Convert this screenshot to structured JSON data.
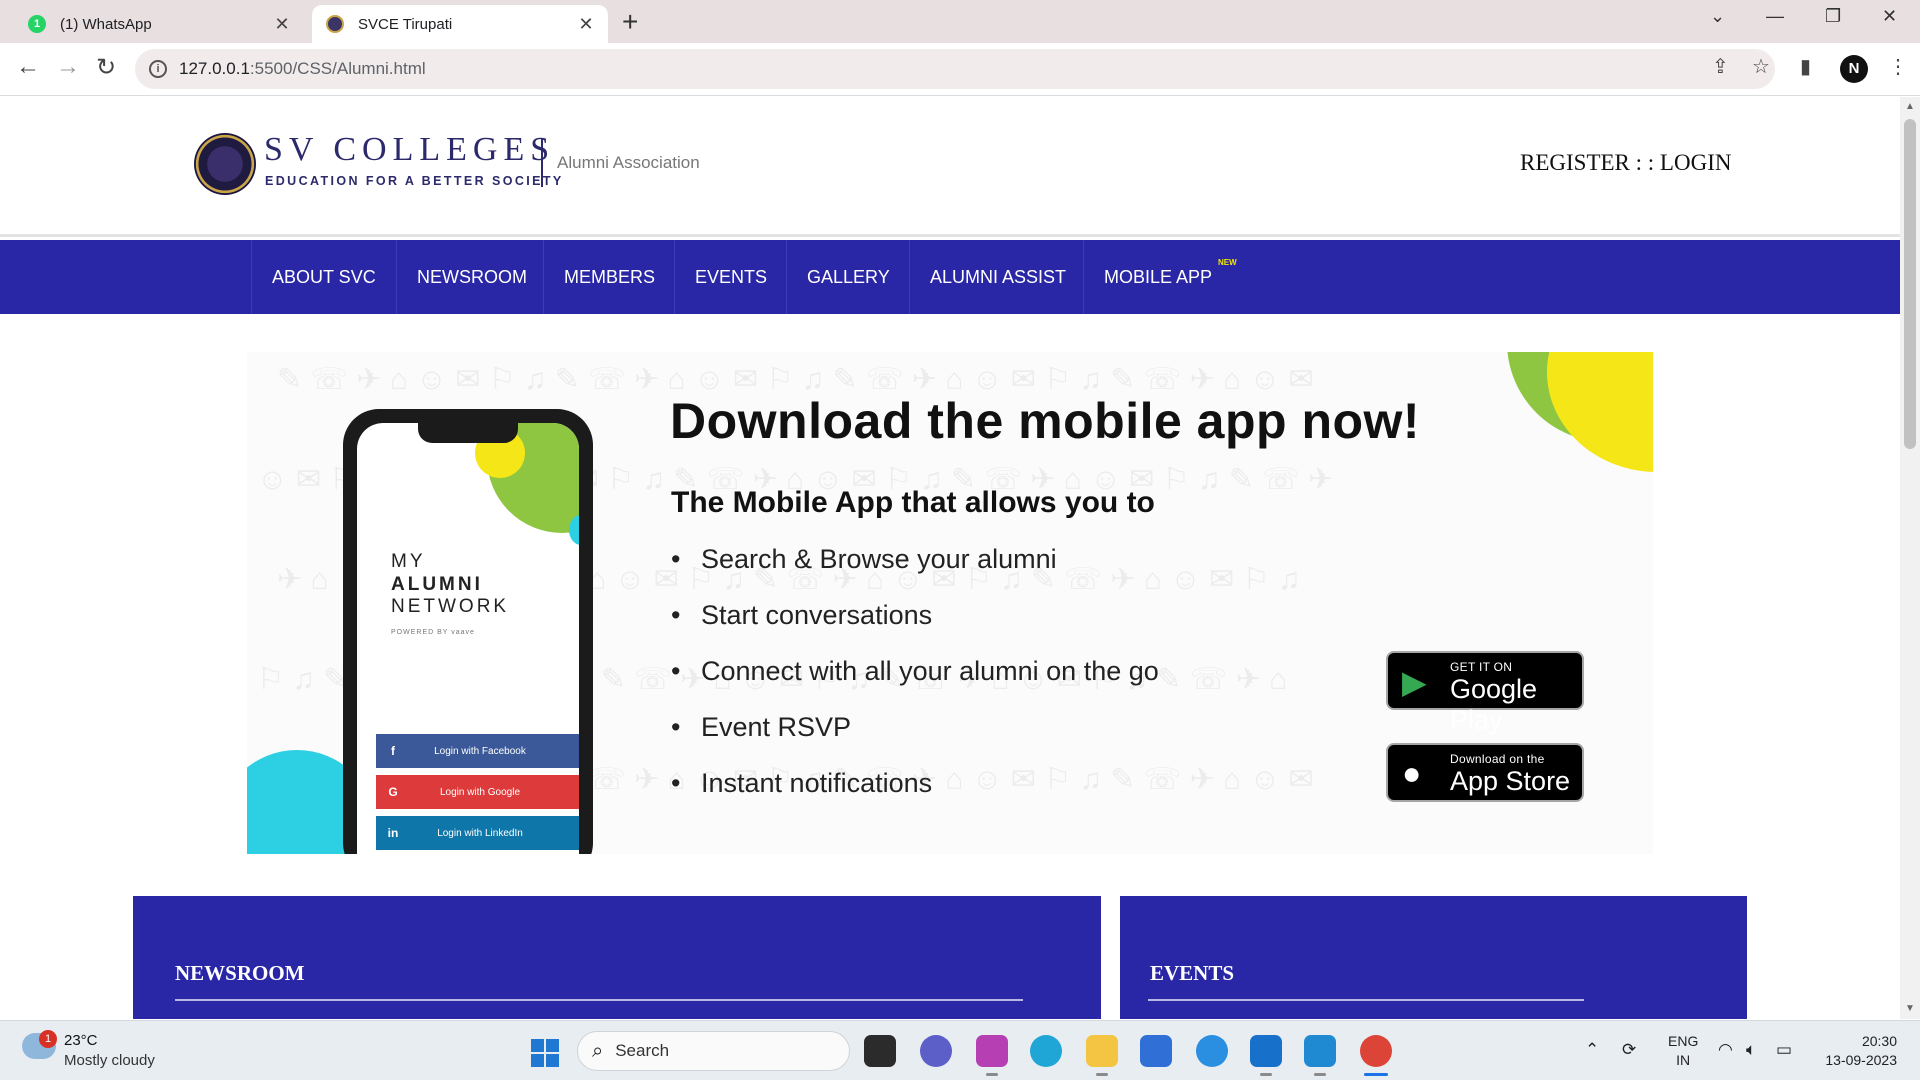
{
  "browser": {
    "tabs": [
      {
        "title": "(1) WhatsApp",
        "badge": "1",
        "active": false
      },
      {
        "title": "SVCE Tirupati",
        "active": true
      }
    ],
    "url_host": "127.0.0.1",
    "url_rest": ":5500/CSS/Alumni.html"
  },
  "header": {
    "brand": "SV COLLEGES",
    "tagline": "EDUCATION FOR A BETTER SOCIETY",
    "association": "Alumni Association",
    "auth_links": "REGISTER : : LOGIN"
  },
  "nav": {
    "items": [
      "ABOUT SVC",
      "NEWSROOM",
      "MEMBERS",
      "EVENTS",
      "GALLERY",
      "ALUMNI ASSIST",
      "MOBILE APP"
    ],
    "badge": "NEW"
  },
  "banner": {
    "title": "Download the mobile app now!",
    "subtitle": "The Mobile App that allows you to",
    "features": [
      "Search & Browse your alumni",
      "Start conversations",
      "Connect with all your alumni on the go",
      "Event RSVP",
      "Instant notifications"
    ],
    "phone": {
      "line1": "MY",
      "line2": "ALUMNI",
      "line3": "NETWORK",
      "powered": "POWERED BY vaave",
      "buttons": [
        {
          "glyph": "f",
          "label": "Login with Facebook",
          "color": "#3b5998"
        },
        {
          "glyph": "G",
          "label": "Login with Google",
          "color": "#dd3b3b"
        },
        {
          "glyph": "in",
          "label": "Login with LinkedIn",
          "color": "#0e76a8"
        }
      ]
    },
    "google_play": {
      "small": "GET IT ON",
      "big": "Google Play"
    },
    "app_store": {
      "small": "Download on the",
      "big": "App Store"
    }
  },
  "panels": {
    "newsroom": "NEWSROOM",
    "events": "EVENTS"
  },
  "taskbar": {
    "weather_temp": "23°C",
    "weather_desc": "Mostly cloudy",
    "weather_badge": "1",
    "search_label": "Search",
    "lang_line1": "ENG",
    "lang_line2": "IN",
    "time": "20:30",
    "date": "13-09-2023"
  },
  "colors": {
    "nav_bg": "#2a27a6",
    "brand": "#2d2a6b",
    "accent_green": "#8fc641",
    "accent_yellow": "#f5e617",
    "accent_cyan": "#2dcfe3"
  }
}
